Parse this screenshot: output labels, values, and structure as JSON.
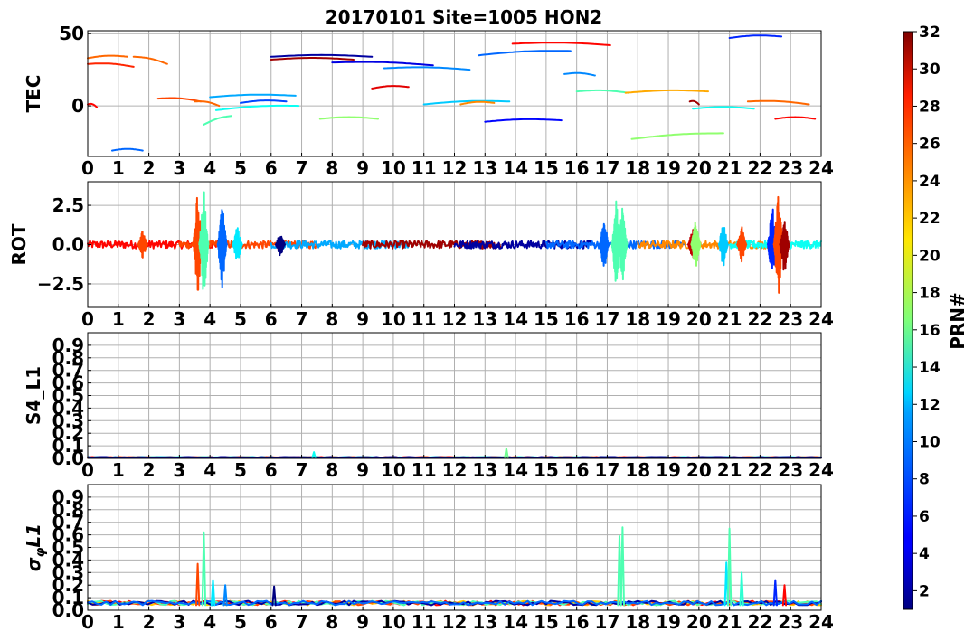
{
  "title": "20170101 Site=1005 HON2",
  "colorbar": {
    "label": "PRN#",
    "min": 1,
    "max": 32,
    "ticks": [
      "2",
      "4",
      "6",
      "8",
      "10",
      "12",
      "14",
      "16",
      "18",
      "20",
      "22",
      "24",
      "26",
      "28",
      "30",
      "32"
    ],
    "colormap": "jet"
  },
  "chart_data": [
    {
      "type": "line",
      "ylabel": "TEC",
      "ylim": [
        -35,
        52
      ],
      "yticks": [
        "0",
        "50"
      ],
      "xlim": [
        0,
        24
      ],
      "xticks": [
        "0",
        "1",
        "2",
        "3",
        "4",
        "5",
        "6",
        "7",
        "8",
        "9",
        "10",
        "11",
        "12",
        "13",
        "14",
        "15",
        "16",
        "17",
        "18",
        "19",
        "20",
        "21",
        "22",
        "23",
        "24"
      ],
      "grid": true,
      "series": [
        {
          "prn": 28,
          "x": [
            0,
            0.3
          ],
          "y": [
            1,
            -1
          ]
        },
        {
          "prn": 25,
          "x": [
            0,
            1.3
          ],
          "y": [
            33,
            34
          ]
        },
        {
          "prn": 27,
          "x": [
            0,
            1.5
          ],
          "y": [
            29,
            27
          ]
        },
        {
          "prn": 25,
          "x": [
            1.5,
            2.6
          ],
          "y": [
            34,
            29
          ]
        },
        {
          "prn": 8,
          "x": [
            0.8,
            1.8
          ],
          "y": [
            -31,
            -31
          ]
        },
        {
          "prn": 26,
          "x": [
            2.3,
            3.7
          ],
          "y": [
            5,
            3
          ]
        },
        {
          "prn": 25,
          "x": [
            3.5,
            4.3
          ],
          "y": [
            3,
            0
          ]
        },
        {
          "prn": 10,
          "x": [
            4,
            6.8
          ],
          "y": [
            6,
            7
          ]
        },
        {
          "prn": 15,
          "x": [
            3.8,
            4.7
          ],
          "y": [
            -13,
            -7
          ]
        },
        {
          "prn": 13,
          "x": [
            4.2,
            6.9
          ],
          "y": [
            -3,
            0
          ]
        },
        {
          "prn": 7,
          "x": [
            5,
            6.5
          ],
          "y": [
            2,
            3
          ]
        },
        {
          "prn": 2,
          "x": [
            6,
            9.3
          ],
          "y": [
            34,
            34
          ]
        },
        {
          "prn": 31,
          "x": [
            6,
            8.7
          ],
          "y": [
            32,
            32
          ]
        },
        {
          "prn": 4,
          "x": [
            8,
            11.3
          ],
          "y": [
            30,
            28
          ]
        },
        {
          "prn": 9,
          "x": [
            9.7,
            12.5
          ],
          "y": [
            26,
            25
          ]
        },
        {
          "prn": 17,
          "x": [
            7.6,
            9.5
          ],
          "y": [
            -9,
            -9
          ]
        },
        {
          "prn": 29,
          "x": [
            9.3,
            10.5
          ],
          "y": [
            12,
            13
          ]
        },
        {
          "prn": 11,
          "x": [
            11,
            13.8
          ],
          "y": [
            1,
            3
          ]
        },
        {
          "prn": 24,
          "x": [
            12.2,
            13.3
          ],
          "y": [
            1,
            2
          ]
        },
        {
          "prn": 8,
          "x": [
            12.8,
            15.8
          ],
          "y": [
            35,
            38
          ]
        },
        {
          "prn": 28,
          "x": [
            13.9,
            17.1
          ],
          "y": [
            43,
            42
          ]
        },
        {
          "prn": 5,
          "x": [
            13,
            15.5
          ],
          "y": [
            -11,
            -10
          ]
        },
        {
          "prn": 9,
          "x": [
            15.6,
            16.6
          ],
          "y": [
            22,
            21
          ]
        },
        {
          "prn": 15,
          "x": [
            16,
            17.7
          ],
          "y": [
            10,
            9
          ]
        },
        {
          "prn": 23,
          "x": [
            17.6,
            20.3
          ],
          "y": [
            9,
            10
          ]
        },
        {
          "prn": 17,
          "x": [
            17.8,
            20.8
          ],
          "y": [
            -23,
            -19
          ]
        },
        {
          "prn": 31,
          "x": [
            19.7,
            20
          ],
          "y": [
            3,
            1
          ]
        },
        {
          "prn": 13,
          "x": [
            19.8,
            21.8
          ],
          "y": [
            -2,
            -2
          ]
        },
        {
          "prn": 6,
          "x": [
            21,
            22.7
          ],
          "y": [
            47,
            48
          ]
        },
        {
          "prn": 25,
          "x": [
            21.6,
            23.6
          ],
          "y": [
            3,
            1
          ]
        },
        {
          "prn": 28,
          "x": [
            22.5,
            23.8
          ],
          "y": [
            -9,
            -9
          ]
        }
      ]
    },
    {
      "type": "line",
      "ylabel": "ROT",
      "ylim": [
        -4,
        4
      ],
      "yticks": [
        "−2.5",
        "0.0",
        "2.5"
      ],
      "xlim": [
        0,
        24
      ],
      "xticks": [
        "0",
        "1",
        "2",
        "3",
        "4",
        "5",
        "6",
        "7",
        "8",
        "9",
        "10",
        "11",
        "12",
        "13",
        "14",
        "15",
        "16",
        "17",
        "18",
        "19",
        "20",
        "21",
        "22",
        "23",
        "24"
      ],
      "grid": true,
      "events": [
        {
          "prn": 26,
          "x": 1.8,
          "amp": 1.0
        },
        {
          "prn": 26,
          "x": 3.6,
          "amp": 3.6
        },
        {
          "prn": 15,
          "x": 3.8,
          "amp": 3.8
        },
        {
          "prn": 8,
          "x": 4.4,
          "amp": 2.8
        },
        {
          "prn": 12,
          "x": 4.9,
          "amp": 1.3
        },
        {
          "prn": 1,
          "x": 6.3,
          "amp": 0.8
        },
        {
          "prn": 15,
          "x": 17.3,
          "amp": 3.0
        },
        {
          "prn": 8,
          "x": 16.9,
          "amp": 1.8
        },
        {
          "prn": 15,
          "x": 17.5,
          "amp": 2.5
        },
        {
          "prn": 30,
          "x": 19.8,
          "amp": 1.1
        },
        {
          "prn": 17,
          "x": 19.9,
          "amp": 1.8
        },
        {
          "prn": 11,
          "x": 20.8,
          "amp": 1.5
        },
        {
          "prn": 26,
          "x": 21.4,
          "amp": 1.2
        },
        {
          "prn": 6,
          "x": 22.4,
          "amp": 2.8
        },
        {
          "prn": 26,
          "x": 22.6,
          "amp": 3.5
        },
        {
          "prn": 31,
          "x": 22.8,
          "amp": 2.0
        }
      ]
    },
    {
      "type": "line",
      "ylabel": "S4_L1",
      "ylim": [
        0,
        1
      ],
      "yticks": [
        "0.0",
        "0.1",
        "0.2",
        "0.3",
        "0.4",
        "0.5",
        "0.6",
        "0.7",
        "0.8",
        "0.9"
      ],
      "xlim": [
        0,
        24
      ],
      "xticks": [
        "0",
        "1",
        "2",
        "3",
        "4",
        "5",
        "6",
        "7",
        "8",
        "9",
        "10",
        "11",
        "12",
        "13",
        "14",
        "15",
        "16",
        "17",
        "18",
        "19",
        "20",
        "21",
        "22",
        "23",
        "24"
      ],
      "grid": true,
      "spikes": [
        {
          "prn": 13,
          "x": 7.4,
          "y": 0.05
        },
        {
          "prn": 16,
          "x": 13.7,
          "y": 0.08
        }
      ]
    },
    {
      "type": "line",
      "ylabel": "σ_φL1",
      "ylim": [
        0,
        1
      ],
      "yticks": [
        "0.0",
        "0.1",
        "0.2",
        "0.3",
        "0.4",
        "0.5",
        "0.6",
        "0.7",
        "0.8",
        "0.9"
      ],
      "xlim": [
        0,
        24
      ],
      "xticks": [
        "0",
        "1",
        "2",
        "3",
        "4",
        "5",
        "6",
        "7",
        "8",
        "9",
        "10",
        "11",
        "12",
        "13",
        "14",
        "15",
        "16",
        "17",
        "18",
        "19",
        "20",
        "21",
        "22",
        "23",
        "24"
      ],
      "grid": true,
      "spikes": [
        {
          "prn": 26,
          "x": 3.6,
          "y": 0.37
        },
        {
          "prn": 15,
          "x": 3.8,
          "y": 0.62
        },
        {
          "prn": 12,
          "x": 4.1,
          "y": 0.24
        },
        {
          "prn": 9,
          "x": 4.5,
          "y": 0.2
        },
        {
          "prn": 1,
          "x": 6.1,
          "y": 0.19
        },
        {
          "prn": 15,
          "x": 17.4,
          "y": 0.59
        },
        {
          "prn": 15,
          "x": 17.5,
          "y": 0.66
        },
        {
          "prn": 12,
          "x": 20.9,
          "y": 0.38
        },
        {
          "prn": 15,
          "x": 21.0,
          "y": 0.65
        },
        {
          "prn": 14,
          "x": 21.4,
          "y": 0.3
        },
        {
          "prn": 6,
          "x": 22.5,
          "y": 0.24
        },
        {
          "prn": 28,
          "x": 22.8,
          "y": 0.2
        }
      ]
    }
  ]
}
